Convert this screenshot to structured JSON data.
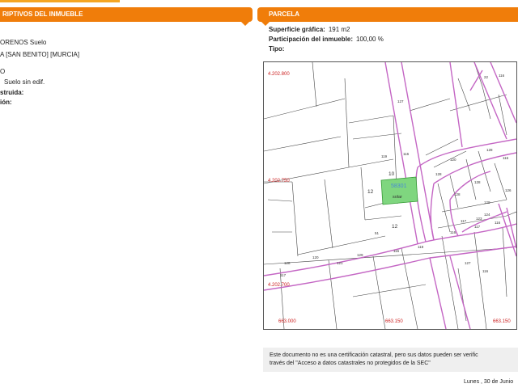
{
  "left_panel": {
    "header": "RIPTIVOS DEL INMUEBLE",
    "lines": [
      {
        "text": "ORENOS  Suelo",
        "bold": false
      },
      {
        "text": "A [SAN BENITO] [MURCIA]",
        "bold": false
      },
      {
        "text": "O",
        "bold": false
      },
      {
        "text": "Suelo sin edif.",
        "bold": false
      },
      {
        "text": "struida:",
        "bold": true
      },
      {
        "text": "ión:",
        "bold": true
      }
    ]
  },
  "right_panel": {
    "header": "PARCELA",
    "fields": [
      {
        "label": "Superficie gráfica:",
        "value": "191 m2"
      },
      {
        "label": "Participación del inmueble:",
        "value": "100,00 %"
      },
      {
        "label": "Tipo:",
        "value": ""
      }
    ]
  },
  "map": {
    "coord_labels": [
      "4.202.800",
      "4.202.750",
      "4.202.700",
      "663.000",
      "663.150",
      "663.150"
    ],
    "parcel_label": "58301",
    "parcel_sub": "solar",
    "block_numbers": [
      "10",
      "12",
      "12",
      "51",
      "119",
      "116",
      "22",
      "127",
      "128",
      "120",
      "128",
      "117",
      "123",
      "124",
      "128",
      "116",
      "116",
      "126",
      "128",
      "120",
      "121",
      "129",
      "116",
      "117",
      "129",
      "128",
      "116",
      "127",
      "116",
      "118",
      "117",
      "116"
    ],
    "colors": {
      "street": "#c466c4",
      "lot": "#444444",
      "highlight": "#7fd67f",
      "coord": "#cc2222"
    }
  },
  "footer": {
    "note_line1": "Este documento no es una certificación catastral, pero sus datos pueden ser verific",
    "note_line2": "través del \"Acceso a datos catastrales no protegidos de la SEC\"",
    "date": "Lunes , 30 de Junio"
  }
}
